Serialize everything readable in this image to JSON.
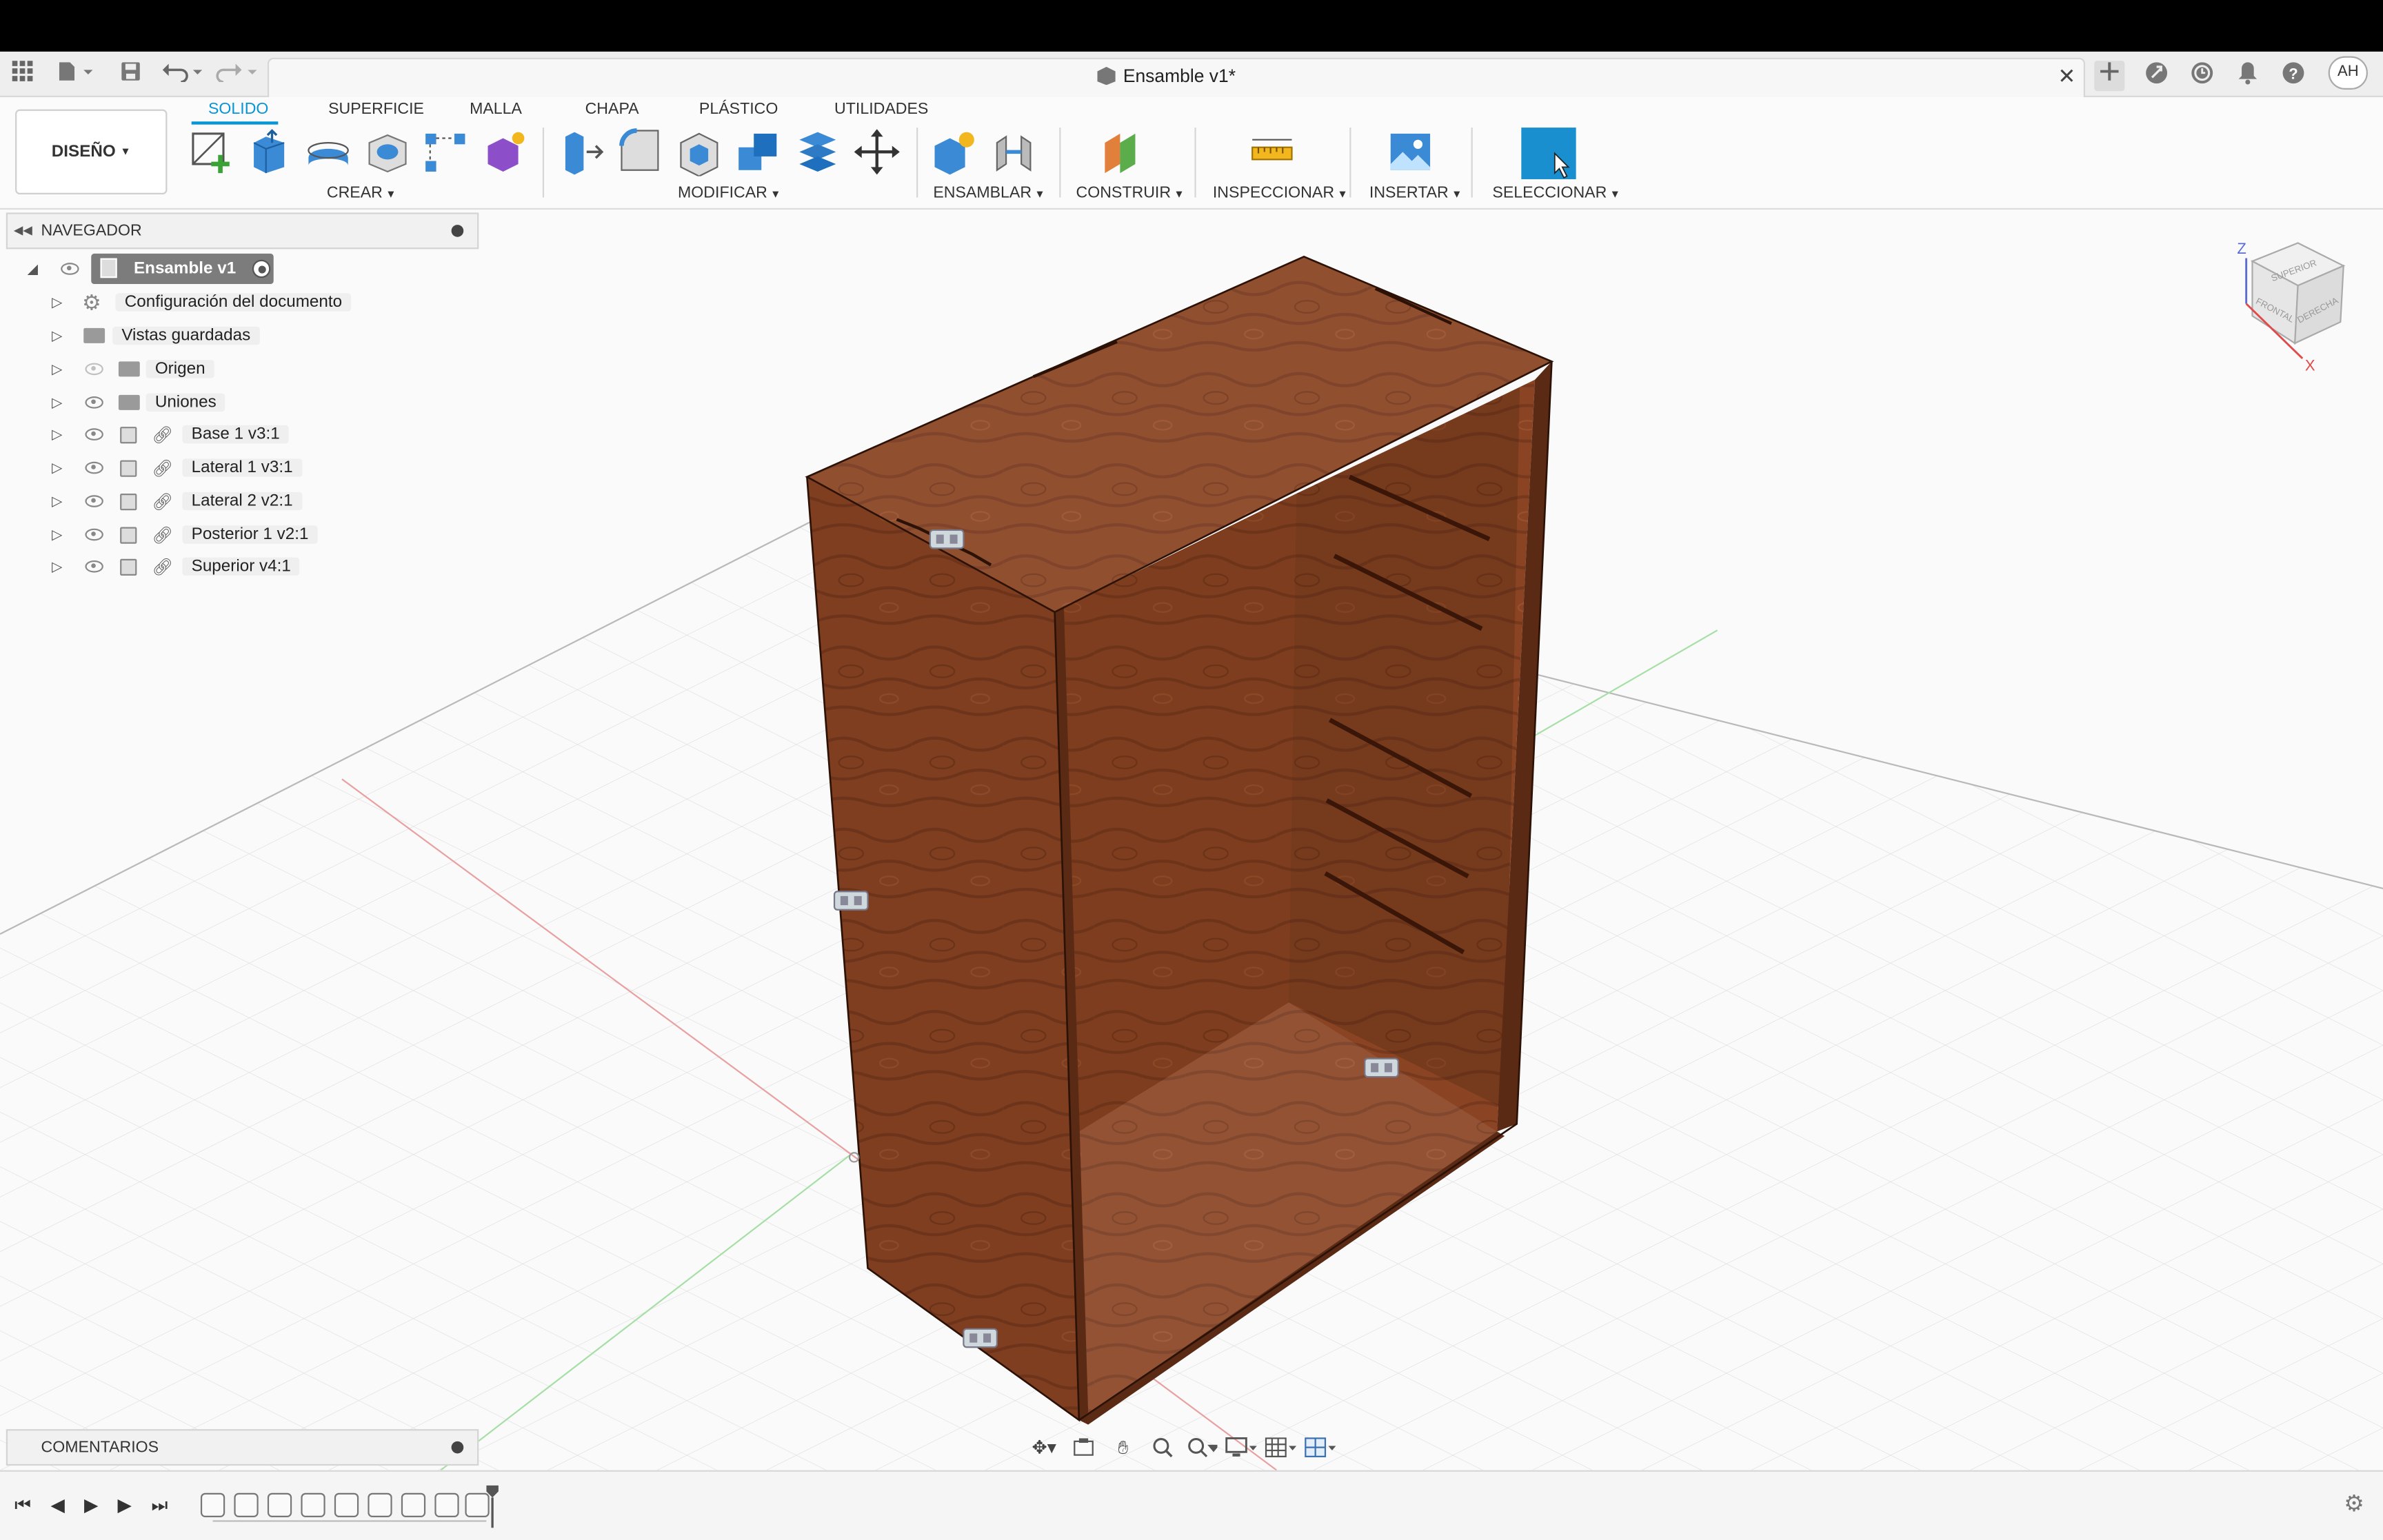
{
  "window": {
    "title": "Ensamble v1*"
  },
  "user": {
    "initials": "AH"
  },
  "workspace": {
    "label": "DISEÑO"
  },
  "tabs": [
    {
      "label": "SOLIDO",
      "active": true
    },
    {
      "label": "SUPERFICIE",
      "active": false
    },
    {
      "label": "MALLA",
      "active": false
    },
    {
      "label": "CHAPA",
      "active": false
    },
    {
      "label": "PLÁSTICO",
      "active": false
    },
    {
      "label": "UTILIDADES",
      "active": false
    }
  ],
  "groups": {
    "crear": "CREAR",
    "modificar": "MODIFICAR",
    "ensamblar": "ENSAMBLAR",
    "construir": "CONSTRUIR",
    "inspeccionar": "INSPECCIONAR",
    "insertar": "INSERTAR",
    "seleccionar": "SELECCIONAR"
  },
  "browser": {
    "header": "NAVEGADOR",
    "root": "Ensamble v1",
    "items": [
      {
        "label": "Configuración del documento",
        "icon": "gear-icon"
      },
      {
        "label": "Vistas guardadas",
        "icon": "folder-icon"
      },
      {
        "label": "Origen",
        "icon": "folder-icon",
        "hidden": true
      },
      {
        "label": "Uniones",
        "icon": "folder-icon"
      },
      {
        "label": "Base 1 v3:1",
        "icon": "component-link-icon"
      },
      {
        "label": "Lateral 1 v3:1",
        "icon": "component-link-icon"
      },
      {
        "label": "Lateral 2 v2:1",
        "icon": "component-link-icon"
      },
      {
        "label": "Posterior 1 v2:1",
        "icon": "component-link-icon"
      },
      {
        "label": "Superior v4:1",
        "icon": "component-link-icon"
      }
    ]
  },
  "comments": {
    "header": "COMENTARIOS"
  },
  "viewcube": {
    "top": "SUPERIOR",
    "front": "FRONTAL",
    "right": "DERECHA",
    "axis_z": "Z",
    "axis_x": "X"
  },
  "colors": {
    "accent": "#0696d7",
    "wood": "#8a4423",
    "select_active": "#1a8fd0"
  }
}
